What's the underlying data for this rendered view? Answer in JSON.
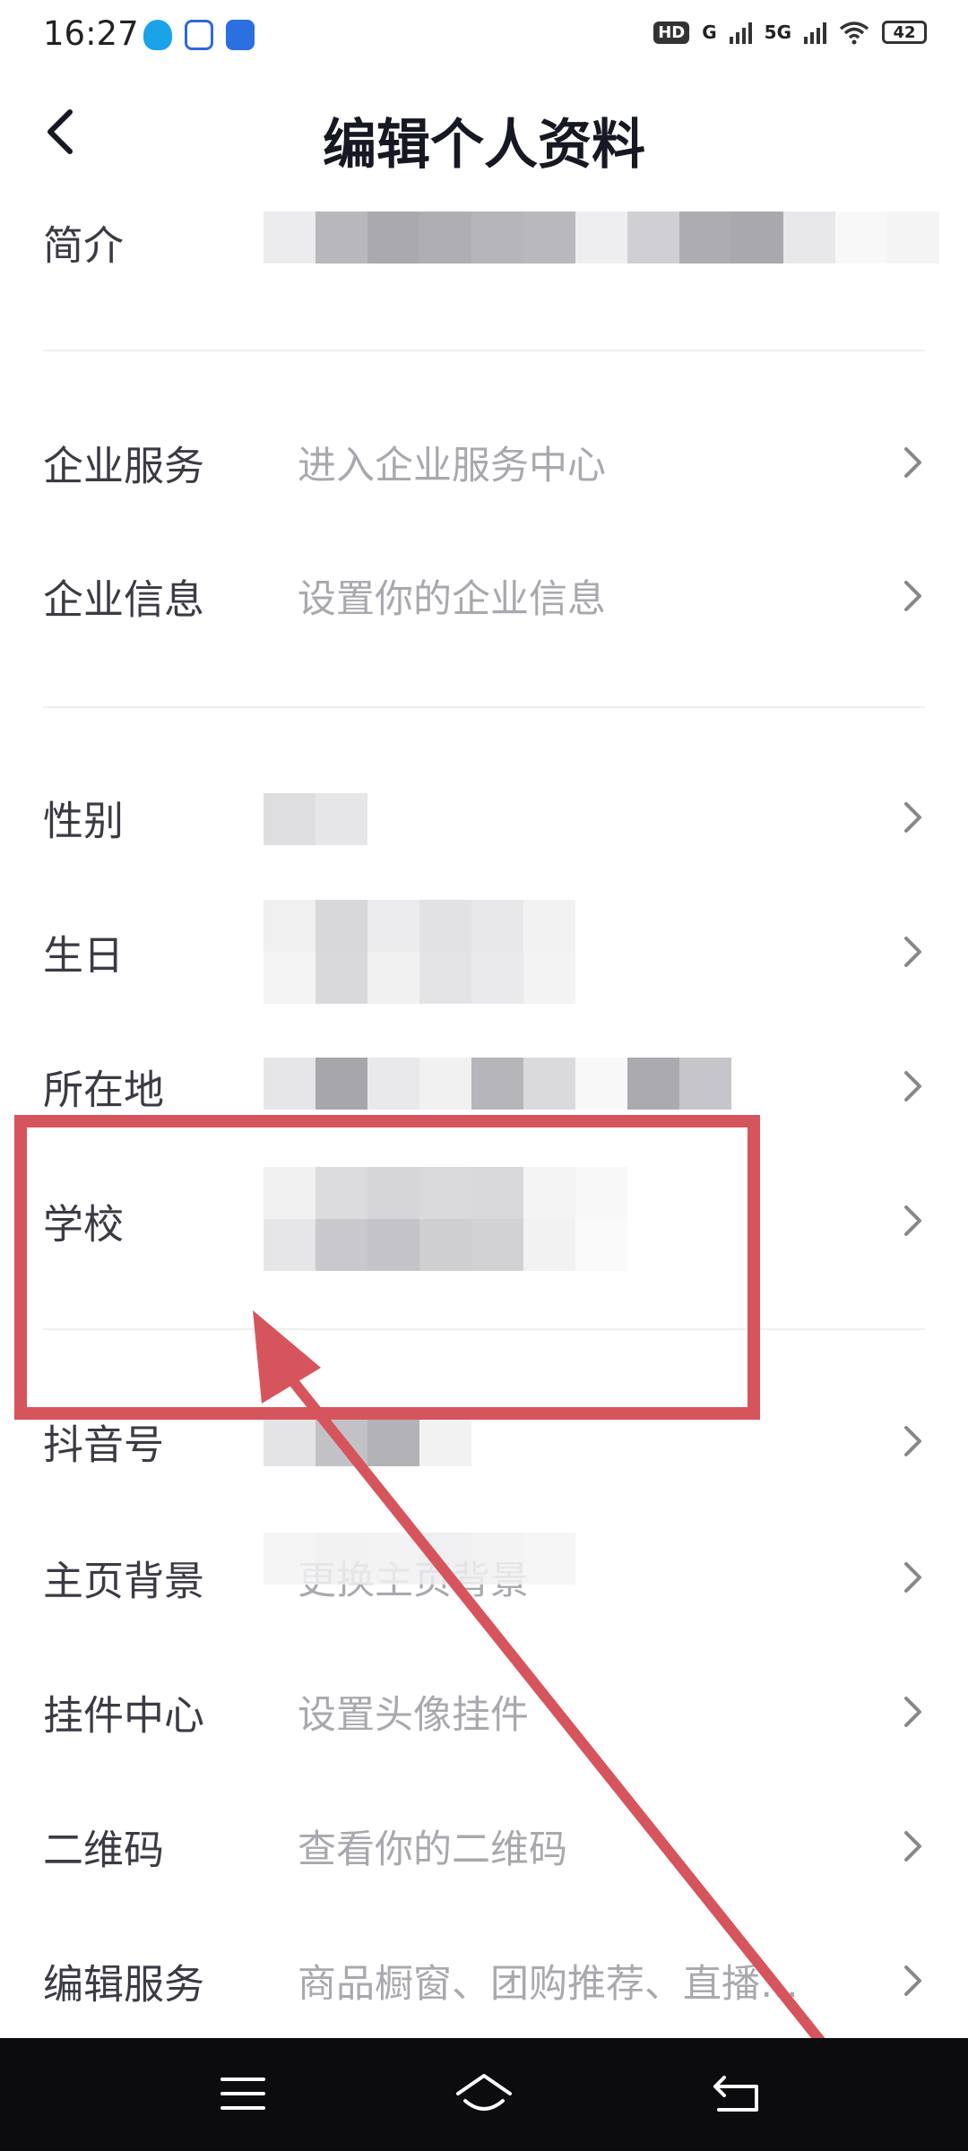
{
  "status_bar": {
    "time": "16:27",
    "hd": "HD",
    "net1": "G",
    "net2": "5G",
    "battery": "42"
  },
  "header": {
    "title": "编辑个人资料"
  },
  "rows": [
    {
      "label": "简介",
      "value": ""
    },
    {
      "label": "企业服务",
      "value": "进入企业服务中心"
    },
    {
      "label": "企业信息",
      "value": "设置你的企业信息"
    },
    {
      "label": "性别",
      "value": ""
    },
    {
      "label": "生日",
      "value": ""
    },
    {
      "label": "所在地",
      "value": ""
    },
    {
      "label": "学校",
      "value": ""
    },
    {
      "label": "抖音号",
      "value": ""
    },
    {
      "label": "主页背景",
      "value": "更换主页背景"
    },
    {
      "label": "挂件中心",
      "value": "设置头像挂件"
    },
    {
      "label": "二维码",
      "value": "查看你的二维码"
    },
    {
      "label": "编辑服务",
      "value": "商品橱窗、团购推荐、直播…"
    }
  ],
  "icons": {
    "back": "chevron-left-icon",
    "row_arrow": "chevron-right-icon"
  },
  "colors": {
    "annotation": "#d6555d",
    "nav_bar": "#0c0c0e"
  }
}
